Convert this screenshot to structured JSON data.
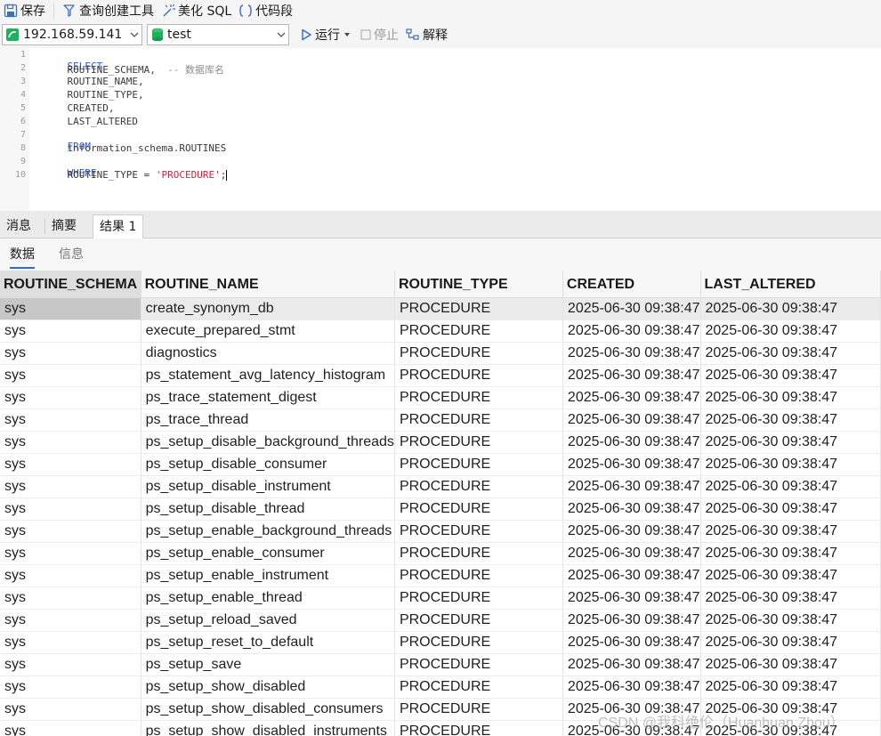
{
  "toolbar": {
    "save_label": "保存",
    "query_builder_label": "查询创建工具",
    "beautify_label": "美化 SQL",
    "snippet_label": "代码段"
  },
  "connection": {
    "host": "192.168.59.141",
    "database": "test",
    "run_label": "运行",
    "stop_label": "停止",
    "explain_label": "解释"
  },
  "editor": {
    "line_numbers": [
      "1",
      "2",
      "3",
      "4",
      "5",
      "6",
      "7",
      "8",
      "9",
      "10"
    ],
    "lines": {
      "l1_kw": "SELECT",
      "l2_code": "    ROUTINE_SCHEMA,  ",
      "l2_comment": "-- 数据库名",
      "l3_code": "    ROUTINE_NAME,",
      "l4_code": "    ROUTINE_TYPE,",
      "l5_code": "    CREATED,",
      "l6_code": "    LAST_ALTERED",
      "l7_kw": "FROM",
      "l8_code": "    information_schema.ROUTINES",
      "l9_kw": "WHERE",
      "l10_code": "    ROUTINE_TYPE = ",
      "l10_str": "'PROCEDURE'",
      "l10_end": ";"
    }
  },
  "result_tabs": [
    "消息",
    "摘要",
    "结果 1"
  ],
  "sub_tabs": [
    "数据",
    "信息"
  ],
  "grid": {
    "columns": [
      "ROUTINE_SCHEMA",
      "ROUTINE_NAME",
      "ROUTINE_TYPE",
      "CREATED",
      "LAST_ALTERED"
    ],
    "rows": [
      [
        "sys",
        "create_synonym_db",
        "PROCEDURE",
        "2025-06-30 09:38:47",
        "2025-06-30 09:38:47"
      ],
      [
        "sys",
        "execute_prepared_stmt",
        "PROCEDURE",
        "2025-06-30 09:38:47",
        "2025-06-30 09:38:47"
      ],
      [
        "sys",
        "diagnostics",
        "PROCEDURE",
        "2025-06-30 09:38:47",
        "2025-06-30 09:38:47"
      ],
      [
        "sys",
        "ps_statement_avg_latency_histogram",
        "PROCEDURE",
        "2025-06-30 09:38:47",
        "2025-06-30 09:38:47"
      ],
      [
        "sys",
        "ps_trace_statement_digest",
        "PROCEDURE",
        "2025-06-30 09:38:47",
        "2025-06-30 09:38:47"
      ],
      [
        "sys",
        "ps_trace_thread",
        "PROCEDURE",
        "2025-06-30 09:38:47",
        "2025-06-30 09:38:47"
      ],
      [
        "sys",
        "ps_setup_disable_background_threads",
        "PROCEDURE",
        "2025-06-30 09:38:47",
        "2025-06-30 09:38:47"
      ],
      [
        "sys",
        "ps_setup_disable_consumer",
        "PROCEDURE",
        "2025-06-30 09:38:47",
        "2025-06-30 09:38:47"
      ],
      [
        "sys",
        "ps_setup_disable_instrument",
        "PROCEDURE",
        "2025-06-30 09:38:47",
        "2025-06-30 09:38:47"
      ],
      [
        "sys",
        "ps_setup_disable_thread",
        "PROCEDURE",
        "2025-06-30 09:38:47",
        "2025-06-30 09:38:47"
      ],
      [
        "sys",
        "ps_setup_enable_background_threads",
        "PROCEDURE",
        "2025-06-30 09:38:47",
        "2025-06-30 09:38:47"
      ],
      [
        "sys",
        "ps_setup_enable_consumer",
        "PROCEDURE",
        "2025-06-30 09:38:47",
        "2025-06-30 09:38:47"
      ],
      [
        "sys",
        "ps_setup_enable_instrument",
        "PROCEDURE",
        "2025-06-30 09:38:47",
        "2025-06-30 09:38:47"
      ],
      [
        "sys",
        "ps_setup_enable_thread",
        "PROCEDURE",
        "2025-06-30 09:38:47",
        "2025-06-30 09:38:47"
      ],
      [
        "sys",
        "ps_setup_reload_saved",
        "PROCEDURE",
        "2025-06-30 09:38:47",
        "2025-06-30 09:38:47"
      ],
      [
        "sys",
        "ps_setup_reset_to_default",
        "PROCEDURE",
        "2025-06-30 09:38:47",
        "2025-06-30 09:38:47"
      ],
      [
        "sys",
        "ps_setup_save",
        "PROCEDURE",
        "2025-06-30 09:38:47",
        "2025-06-30 09:38:47"
      ],
      [
        "sys",
        "ps_setup_show_disabled",
        "PROCEDURE",
        "2025-06-30 09:38:47",
        "2025-06-30 09:38:47"
      ],
      [
        "sys",
        "ps_setup_show_disabled_consumers",
        "PROCEDURE",
        "2025-06-30 09:38:47",
        "2025-06-30 09:38:47"
      ],
      [
        "sys",
        "ps_setup_show_disabled_instruments",
        "PROCEDURE",
        "2025-06-30 09:38:47",
        "2025-06-30 09:38:47"
      ]
    ]
  },
  "watermark": "CSDN @我科绝伦（Huanhuan Zhou）",
  "colors": {
    "keyword": "#2b57d9",
    "string": "#d4213d",
    "comment": "#8e8e8e",
    "db_icon": "#1fb15a",
    "accent": "#2b6bd8"
  }
}
